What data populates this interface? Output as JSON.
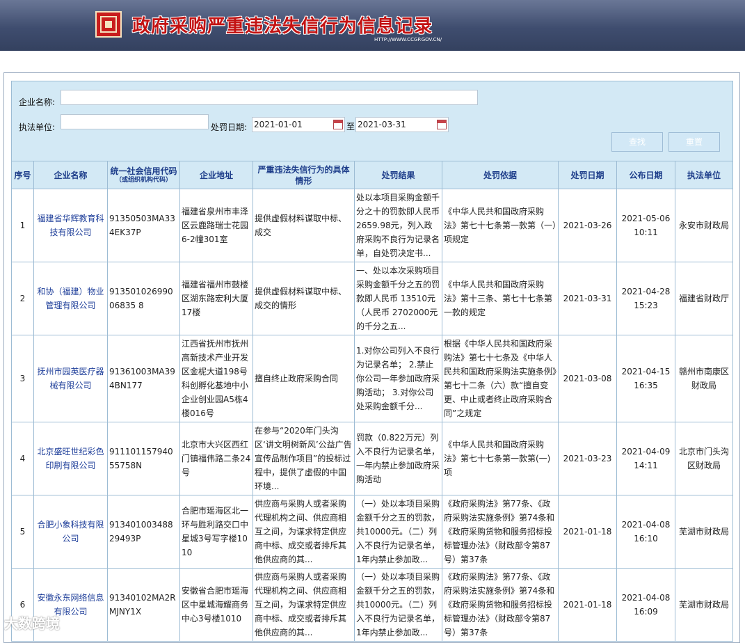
{
  "banner": {
    "title": "政府采购严重违法失信行为信息记录",
    "url": "HTTP://WWW.CCGP.GOV.CN/"
  },
  "search": {
    "company_label": "企业名称:",
    "company_value": "",
    "unit_label": "执法单位:",
    "unit_value": "",
    "date_label": "处罚日期:",
    "date_from": "2021-01-01",
    "date_sep": "至",
    "date_to": "2021-03-31",
    "query_button": "查找",
    "reset_button": "重置"
  },
  "table": {
    "headers": {
      "index": "序号",
      "company": "企业名称",
      "credit_code": "统一社会信用代码",
      "credit_code_sub": "（或组织机构代码）",
      "address": "企业地址",
      "behavior": "严重违法失信行为的具体情形",
      "result": "处罚结果",
      "basis": "处罚依据",
      "penalty_date": "处罚日期",
      "publish_date": "公布日期",
      "unit": "执法单位"
    },
    "rows": [
      {
        "index": "1",
        "company": "福建省华辉教育科技有限公司",
        "credit_code": "91350503MA334EK37P",
        "address": "福建省泉州市丰泽区云鹿路瑞士花园6-2幢301室",
        "behavior": "提供虚假材料谋取中标、成交",
        "result": "处以本项目采购金额千分之十的罚款即人民币2659.98元，列入政府采购不良行为记录名单，自处罚决定书...",
        "basis": "《中华人民共和国政府采购法》第七十七条第一款第（一）项规定",
        "penalty_date": "2021-03-26",
        "publish_date": "2021-05-06 10:11",
        "unit": "永安市财政局"
      },
      {
        "index": "2",
        "company": "和协（福建）物业管理有限公司",
        "credit_code": "91350102699006835 8",
        "address": "福建省福州市鼓楼区湖东路宏利大厦17楼",
        "behavior": "提供虚假材料谋取中标、成交的情形",
        "result": "一、处以本次采购项目采购金额千分之五的罚款即人民币 13510元（人民币 2702000元的千分之五...",
        "basis": "《中华人民共和国政府采购法》第十三条、第七十七条第一款的规定",
        "penalty_date": "2021-03-31",
        "publish_date": "2021-04-28 15:23",
        "unit": "福建省财政厅"
      },
      {
        "index": "3",
        "company": "抚州市园英医疗器械有限公司",
        "credit_code": "91361003MA394BN177",
        "address": "江西省抚州市抚州高新技术产业开发区金柅大道198号科创孵化基地中小企业创业园A5栋4楼016号",
        "behavior": "擅自终止政府采购合同",
        "result": "1.对你公司列入不良行为记录名单； 2.禁止你公司一年参加政府采购活动； 3.对你公司处采购金额千分...",
        "basis": "根据《中华人民共和国政府采购法》第七十七条及《中华人民共和国政府采购法实施条例》第七十二条（六）款“擅自变更、中止或者终止政府采购合同”之规定",
        "penalty_date": "2021-03-08",
        "publish_date": "2021-04-15 16:35",
        "unit": "赣州市南康区财政局"
      },
      {
        "index": "4",
        "company": "北京盛旺世纪彩色印刷有限公司",
        "credit_code": "91110115794055758N",
        "address": "北京市大兴区西红门镇福伟路二条24号",
        "behavior": "在参与“2020年门头沟区‘讲文明树新风’公益广告宣传品制作项目”的投标过程中，提供了虚假的中国环境...",
        "result": "罚款（0.822万元）列入不良行为记录名单，一年内禁止参加政府采购活动",
        "basis": "《中华人民共和国政府采购法》第七十七条第一款第(一)项",
        "penalty_date": "2021-03-23",
        "publish_date": "2021-04-09 14:11",
        "unit": "北京市门头沟区财政局"
      },
      {
        "index": "5",
        "company": "合肥小象科技有限公司",
        "credit_code": "91340100348829493P",
        "address": "合肥市瑶海区北一环与胜利路交口中星城3号写字楼1010",
        "behavior": "供应商与采购人或者采购代理机构之间、供应商相互之间，为谋求特定供应商中标、成交或者排斥其他供应商的其...",
        "result": "（一）处以本项目采购金额千分之五的罚款，共10000元。（二）列入不良行为记录名单，1年内禁止参加政...",
        "basis": "《政府采购法》第77条、《政府采购法实施条例》第74条和《政府采购货物和服务招标投标管理办法》（财政部令第87号）第37条",
        "penalty_date": "2021-01-18",
        "publish_date": "2021-04-08 16:10",
        "unit": "芜湖市财政局"
      },
      {
        "index": "6",
        "company": "安徽永东网络信息有限公司",
        "credit_code": "91340102MA2RMJNY1X",
        "address": "安徽省合肥市瑶海区中星城海耀商务中心3号楼1010",
        "behavior": "供应商与采购人或者采购代理机构之间、供应商相互之间，为谋求特定供应商中标、成交或者排斥其他供应商的其...",
        "result": "（一）处以本项目采购金额千分之五的罚款，共10000元。（二）列入不良行为记录名单，1年内禁止参加政...",
        "basis": "《政府采购法》第77条、《政府采购法实施条例》第74条和《政府采购货物和服务招标投标管理办法》（财政部令第87号）第37条",
        "penalty_date": "2021-01-18",
        "publish_date": "2021-04-08 16:09",
        "unit": "芜湖市财政局"
      }
    ]
  },
  "watermark": "大数跨境"
}
